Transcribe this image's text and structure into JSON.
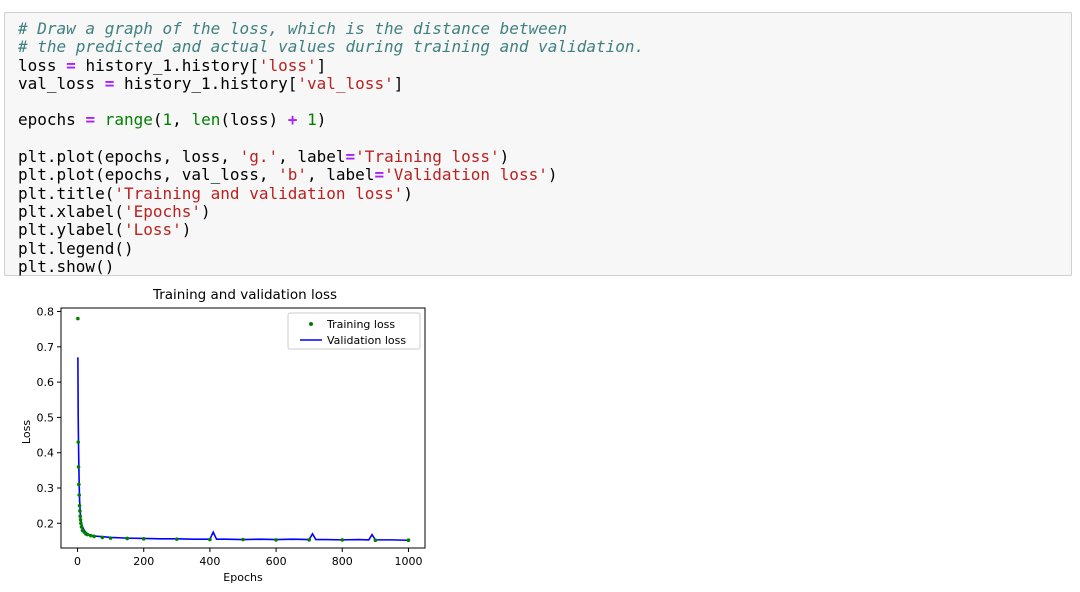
{
  "code_cell": {
    "lines": [
      [
        {
          "t": "# Draw a graph of the loss, which is the distance between",
          "c": "cm"
        }
      ],
      [
        {
          "t": "# the predicted and actual values during training and validation.",
          "c": "cm"
        }
      ],
      [
        {
          "t": "loss "
        },
        {
          "t": "=",
          "c": "op"
        },
        {
          "t": " history_1.history["
        },
        {
          "t": "'loss'",
          "c": "st"
        },
        {
          "t": "]"
        }
      ],
      [
        {
          "t": "val_loss "
        },
        {
          "t": "=",
          "c": "op"
        },
        {
          "t": " history_1.history["
        },
        {
          "t": "'val_loss'",
          "c": "st"
        },
        {
          "t": "]"
        }
      ],
      [],
      [
        {
          "t": "epochs "
        },
        {
          "t": "=",
          "c": "op"
        },
        {
          "t": " "
        },
        {
          "t": "range",
          "c": "nb"
        },
        {
          "t": "("
        },
        {
          "t": "1",
          "c": "nu"
        },
        {
          "t": ", "
        },
        {
          "t": "len",
          "c": "nb"
        },
        {
          "t": "(loss) "
        },
        {
          "t": "+",
          "c": "op"
        },
        {
          "t": " "
        },
        {
          "t": "1",
          "c": "nu"
        },
        {
          "t": ")"
        }
      ],
      [],
      [
        {
          "t": "plt.plot(epochs, loss, "
        },
        {
          "t": "'g.'",
          "c": "st"
        },
        {
          "t": ", label"
        },
        {
          "t": "=",
          "c": "op"
        },
        {
          "t": "'Training loss'",
          "c": "st"
        },
        {
          "t": ")"
        }
      ],
      [
        {
          "t": "plt.plot(epochs, val_loss, "
        },
        {
          "t": "'b'",
          "c": "st"
        },
        {
          "t": ", label"
        },
        {
          "t": "=",
          "c": "op"
        },
        {
          "t": "'Validation loss'",
          "c": "st"
        },
        {
          "t": ")"
        }
      ],
      [
        {
          "t": "plt.title("
        },
        {
          "t": "'Training and validation loss'",
          "c": "st"
        },
        {
          "t": ")"
        }
      ],
      [
        {
          "t": "plt.xlabel("
        },
        {
          "t": "'Epochs'",
          "c": "st"
        },
        {
          "t": ")"
        }
      ],
      [
        {
          "t": "plt.ylabel("
        },
        {
          "t": "'Loss'",
          "c": "st"
        },
        {
          "t": ")"
        }
      ],
      [
        {
          "t": "plt.legend()"
        }
      ],
      [
        {
          "t": "plt.show()"
        }
      ]
    ]
  },
  "colors": {
    "cell_bg": "#f7f7f7",
    "cell_border": "#cfcfcf",
    "comment": "#408080",
    "string": "#ba2121",
    "builtin": "#008000",
    "operator": "#aa22ff",
    "training_series": "#008000",
    "validation_series": "#0000ff"
  },
  "chart_data": {
    "type": "line",
    "title": "Training and validation loss",
    "xlabel": "Epochs",
    "ylabel": "Loss",
    "xlim": [
      -50,
      1050
    ],
    "ylim": [
      0.13,
      0.81
    ],
    "xticks": [
      0,
      200,
      400,
      600,
      800,
      1000
    ],
    "yticks": [
      0.2,
      0.3,
      0.4,
      0.5,
      0.6,
      0.7,
      0.8
    ],
    "grid": false,
    "legend_position": "top-right",
    "series": [
      {
        "name": "Training loss",
        "style": "points",
        "x": [
          1,
          2,
          3,
          4,
          5,
          6,
          7,
          8,
          9,
          10,
          12,
          15,
          20,
          25,
          30,
          40,
          50,
          75,
          100,
          150,
          200,
          300,
          400,
          500,
          600,
          700,
          800,
          900,
          1000
        ],
        "y": [
          0.78,
          0.43,
          0.36,
          0.31,
          0.28,
          0.25,
          0.235,
          0.22,
          0.21,
          0.2,
          0.19,
          0.18,
          0.175,
          0.17,
          0.168,
          0.165,
          0.163,
          0.16,
          0.158,
          0.157,
          0.156,
          0.155,
          0.154,
          0.154,
          0.153,
          0.153,
          0.153,
          0.152,
          0.152
        ]
      },
      {
        "name": "Validation loss",
        "style": "line",
        "x": [
          1,
          2,
          3,
          4,
          5,
          6,
          7,
          8,
          9,
          10,
          12,
          15,
          20,
          25,
          30,
          40,
          50,
          75,
          100,
          150,
          200,
          250,
          300,
          350,
          400,
          410,
          420,
          450,
          500,
          550,
          600,
          650,
          700,
          710,
          720,
          750,
          800,
          850,
          880,
          890,
          900,
          950,
          1000
        ],
        "y": [
          0.67,
          0.5,
          0.42,
          0.36,
          0.31,
          0.27,
          0.25,
          0.235,
          0.22,
          0.21,
          0.2,
          0.19,
          0.18,
          0.175,
          0.17,
          0.166,
          0.164,
          0.162,
          0.16,
          0.158,
          0.157,
          0.156,
          0.156,
          0.155,
          0.155,
          0.175,
          0.155,
          0.155,
          0.154,
          0.155,
          0.154,
          0.155,
          0.154,
          0.17,
          0.154,
          0.154,
          0.153,
          0.154,
          0.153,
          0.168,
          0.153,
          0.153,
          0.152
        ]
      }
    ]
  }
}
